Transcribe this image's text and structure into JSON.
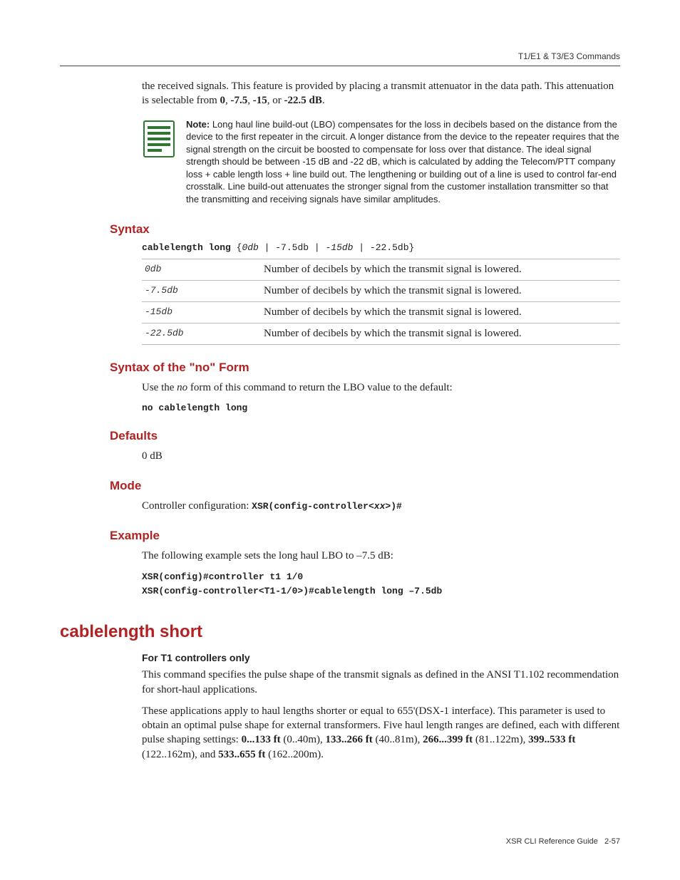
{
  "header": {
    "right": "T1/E1 & T3/E3 Commands"
  },
  "intro": {
    "para1_pre": "the received signals. This feature is provided by placing a transmit attenuator in the data path. This attenuation is selectable from ",
    "b1": "0",
    "sep1": ", ",
    "b2": "-7.5",
    "sep2": ", ",
    "b3": "-15",
    "sep3": ", or ",
    "b4": "-22.5 dB",
    "tail": "."
  },
  "note": {
    "label": "Note:",
    "text": " Long haul line build-out (LBO) compensates for the loss in decibels based on the distance from the device to the first repeater in the circuit. A longer distance from the device to the repeater requires that the signal strength on the circuit be boosted to compensate for loss over that distance. The ideal signal strength should be between -15 dB and -22 dB, which is calculated by adding the Telecom/PTT company loss + cable length loss + line build out. The lengthening or building out of a line is used to control far-end crosstalk. Line build-out attenuates the stronger signal from the customer installation transmitter so that the transmitting and receiving signals have similar amplitudes."
  },
  "sections": {
    "syntax_h": "Syntax",
    "syntax_no_h": "Syntax of the \"no\" Form",
    "defaults_h": "Defaults",
    "mode_h": "Mode",
    "example_h": "Example"
  },
  "syntax": {
    "cmd_bold": "cablelength long",
    "cmd_rest1": " {",
    "cmd_opt1": "0db",
    "sep1": " | ",
    "cmd_opt2": "-7.5db",
    "sep2": " | ",
    "cmd_opt3": "-15db",
    "sep3": " | ",
    "cmd_opt4": "-22.5db",
    "cmd_rest2": "}"
  },
  "params": [
    {
      "key": "0db",
      "desc": "Number of decibels by which the transmit signal is lowered."
    },
    {
      "key": "-7.5db",
      "desc": "Number of decibels by which the transmit signal is lowered."
    },
    {
      "key": "-15db",
      "desc": "Number of decibels by which the transmit signal is lowered."
    },
    {
      "key": "-22.5db",
      "desc": "Number of decibels by which the transmit signal is lowered."
    }
  ],
  "no_form": {
    "text_pre": "Use the ",
    "text_i": "no",
    "text_post": " form of this command to return the LBO value to the default:",
    "cmd": "no cablelength long"
  },
  "defaults": {
    "text": "0 dB"
  },
  "mode": {
    "text_pre": "Controller configuration: ",
    "cmd_pre": "XSR(config-controller<",
    "cmd_var": "xx",
    "cmd_post": ">)#"
  },
  "example": {
    "intro": "The following example sets the long haul LBO to –7.5 dB:",
    "code": "XSR(config)#controller t1 1/0\nXSR(config-controller<T1-1/0>)#cablelength long –7.5db"
  },
  "command2": {
    "title": "cablelength short",
    "sub": "For T1 controllers only",
    "p1": "This command specifies the pulse shape of the transmit signals as defined in the ANSI T1.102 recommendation for short-haul applications.",
    "p2_pre": "These applications apply to haul lengths shorter or equal to 655'(DSX-1 interface). This parameter is used to obtain an optimal pulse shape for external transformers. Five haul length ranges are defined, each with different pulse shaping settings: ",
    "r1": "0...133 ft",
    "r1t": " (0..40m), ",
    "r2": "133..266 ft",
    "r2t": " (40..81m), ",
    "r3": "266...399 ft",
    "r3t": " (81..122m), ",
    "r4": "399..533 ft",
    "r4t": " (122..162m), and ",
    "r5": "533..655 ft",
    "r5t": " (162..200m)."
  },
  "footer": {
    "left": "XSR CLI Reference Guide",
    "right": "2-57"
  }
}
